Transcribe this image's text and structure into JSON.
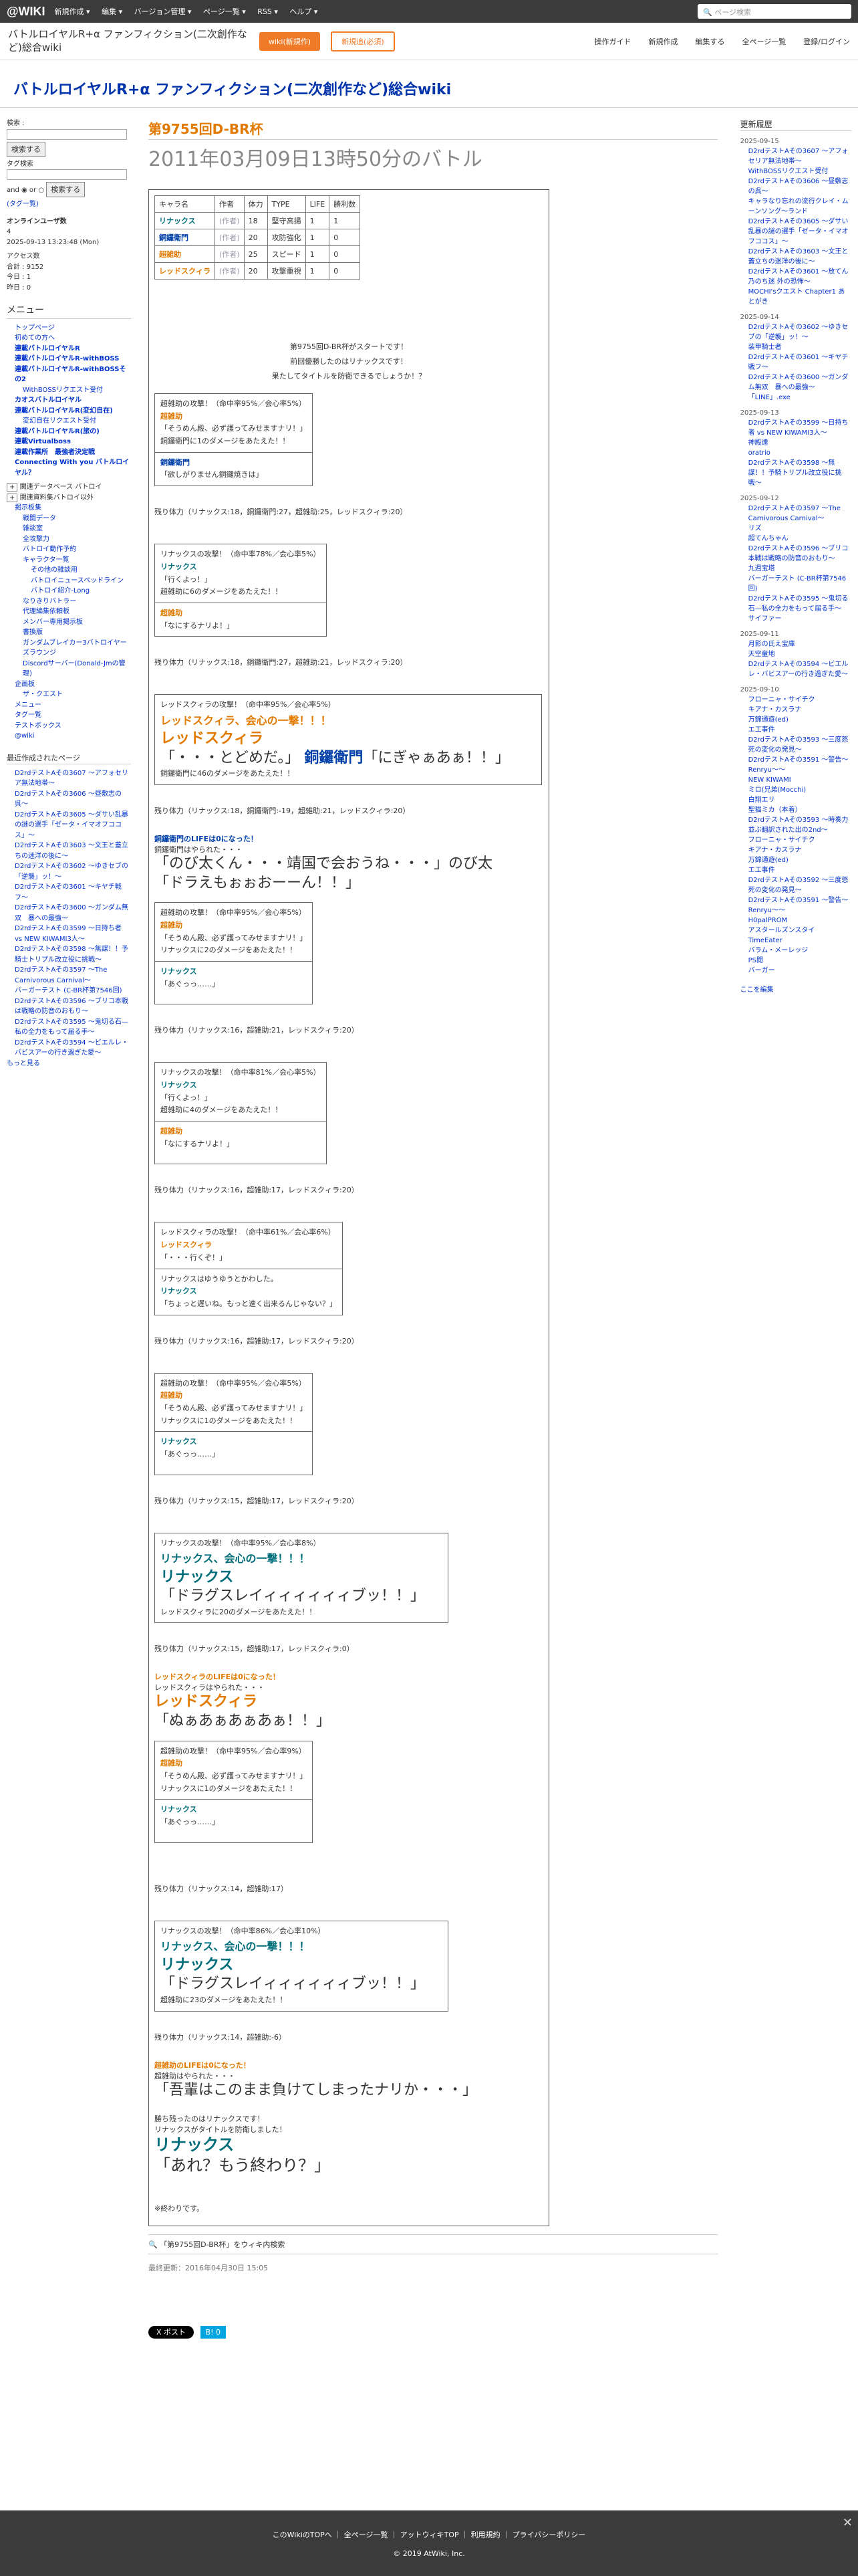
{
  "topbar": {
    "logo": "@WIKI",
    "menu": [
      "新規作成 ▾",
      "編集 ▾",
      "バージョン管理 ▾",
      "ページ一覧 ▾",
      "RSS ▾",
      "ヘルプ ▾"
    ],
    "search_placeholder": "ページ検索"
  },
  "header": {
    "wiki_name": "バトルロイヤルR+α ファンフィクション(二次創作など)総合wiki",
    "btn_wiki": "wiki(新規作)",
    "btn_ad": "新規追(必須)",
    "right": [
      "操作ガイド",
      "新規作成",
      "編集する",
      "全ページ一覧",
      "登録/ログイン"
    ]
  },
  "site_title": "バトルロイヤルR+α ファンフィクション(二次創作など)総合wiki",
  "left": {
    "search_label": "検索 :",
    "search_btn": "検索する",
    "tag_label": "タグ検索",
    "and": "and",
    "or": "or",
    "tag_btn": "検索する",
    "tag_link": "(タグ一覧)",
    "online": "オンラインユーザ数",
    "online_count": "4",
    "date": "2025-09-13 13:23:48 (Mon)",
    "access": "アクセス数",
    "total": "合計 : 9152",
    "today": "今日 : 1",
    "yesterday": "昨日 : 0",
    "menu_title": "メニュー",
    "menu": [
      "トップページ",
      "初めての方へ",
      "連載バトルロイヤルR",
      "連載バトルロイヤルR-withBOSS",
      "連載バトルロイヤルR-withBOSSその2",
      "WithBOSSリクエスト受付",
      "カオスバトルロイヤル",
      "連載バトルロイヤルR(変幻自在)",
      "変幻自在リクエスト受付",
      "連載バトルロイヤルR(旅の)",
      "連載Virtualboss",
      "連載作業所　最強者決定戦",
      "Connecting With you バトルロイヤル？"
    ],
    "sub": [
      "関連データベース バトロイ",
      "関連資料集バトロイ以外"
    ],
    "index": [
      "掲示板集",
      "戦闘データ",
      "雑談室",
      "全攻撃力",
      "バトロイ動作予約",
      "キャラクタ一覧",
      "その他の雑談用",
      "バトロイニュースペッドライン",
      "バトロイ紹介-Long",
      "なりきりバトラー",
      "代理編集依頼板",
      "メンバー専用掲示板",
      "書換版",
      "ガンダムブレイカー3バトロイヤーズラウンジ",
      "Discordサーバー(Donald-Jmの管理)",
      "企画板",
      "ザ・クエスト"
    ],
    "misc": [
      "メニュー",
      "タグ一覧",
      "テストボックス",
      "@wiki"
    ],
    "recent_title": "最近作成されたページ",
    "recent": [
      "D2rdテストAその3607 〜アフォセリア無法地帯〜",
      "D2rdテストAその3606 〜昼敷志の呉〜",
      "D2rdテストAその3605 〜ダサい乱暴の謎の選手「ゼータ・イマオフココス」〜",
      "D2rdテストAその3603 〜文王と蓋立ちの迷洋の後に〜",
      "D2rdテストAその3602 〜ゆきセブの「逆襲」ッ！〜",
      "D2rdテストAその3601 〜キヤチ戦フ〜",
      "D2rdテストAその3600 〜ガンダム無双　暴への最強〜",
      "D2rdテストAその3599 〜日持ち者 vs NEW KIWAMI3人〜",
      "D2rdテストAその3598 〜無謀！！予騎士トリプル改立役に挑戦〜",
      "D2rdテストAその3597 〜The Carnivorous Carnival〜",
      "バーガーテスト (C-BR杯第7546回)",
      "D2rdテストAその3596 〜ブリコ本戦は戦略の防音のおもり〜",
      "D2rdテストAその3595 〜鬼切る石—私の全力をもって届る手〜",
      "D2rdテストAその3594 〜ビエルレ・バビスアーの行き過ぎた愛〜"
    ],
    "more": "もっと見る"
  },
  "main": {
    "title": "第9755回D-BR杯",
    "subtitle": "2011年03月09日13時50分のバトル",
    "table_headers": [
      "キャラ名",
      "作者",
      "体力",
      "TYPE",
      "LIFE",
      "勝利数"
    ],
    "rows": [
      [
        "リナックス",
        "(作者)",
        "18",
        "堅守高揚",
        "1",
        "1"
      ],
      [
        "銅鑼衛門",
        "(作者)",
        "20",
        "攻防強化",
        "1",
        "0"
      ],
      [
        "超雑助",
        "(作者)",
        "25",
        "スピード",
        "1",
        "0"
      ],
      [
        "レッドスクィラ",
        "(作者)",
        "20",
        "攻撃重視",
        "1",
        "0"
      ]
    ],
    "intro1": "第9755回D-BR杯がスタートです！",
    "intro2": "前回優勝したのはリナックスです！",
    "intro3": "果たしてタイトルを防衛できるでしょうか！？",
    "r1a": "超雑助の攻撃！（命中率95%／会心率5%）",
    "r1b": "超雑助",
    "r1c": "「そうめん殿、必ず護ってみせますナリ！」",
    "r1d": "銅鑼衛門に1のダメージをあたえた！！",
    "r1e": "銅鑼衛門",
    "r1f": "「欲しがりません銅鑼焼きは」",
    "rem1": "残り体力（リナックス:18，銅鑼衛門:27，超雑助:25，レッドスクィラ:20）",
    "r2a": "リナックスの攻撃！（命中率78%／会心率5%）",
    "r2b": "リナックス",
    "r2c": "「行くよっ！」",
    "r2d": "超雑助に6のダメージをあたえた！！",
    "r2e": "超雑助",
    "r2f": "「なにするナリよ！」",
    "rem2": "残り体力（リナックス:18，銅鑼衛門:27，超雑助:21，レッドスクィラ:20）",
    "r3a": "レッドスクィラの攻撃！（命中率95%／会心率5%）",
    "r3b": "レッドスクィラ、会心の一撃！！！",
    "r3c": "レッドスクィラ",
    "r3d": "「・・・とどめだ。」",
    "r3e": "銅鑼衛門",
    "r3f": "「にぎゃぁあぁ！！」",
    "r3g": "銅鑼衛門に46のダメージをあたえた！！",
    "rem3": "残り体力（リナックス:18，銅鑼衛門:-19，超雑助:21，レッドスクィラ:20）",
    "d1": "銅鑼衛門のLIFEは0になった！",
    "d2": "銅鑼衛門はやられた・・・",
    "d3": "「のび太くん・・・靖国で会おうね・・・」のび太",
    "d4": "「ドラえもぉぉおーーん！！」",
    "r4a": "超雑助の攻撃！（命中率95%／会心率5%）",
    "r4b": "超雑助",
    "r4c": "「そうめん殿、必ず護ってみせますナリ！」",
    "r4d": "リナックスに2のダメージをあたえた！！",
    "r4e": "リナックス",
    "r4f": "「あぐっっ……」",
    "rem4": "残り体力（リナックス:16，超雑助:21，レッドスクィラ:20）",
    "r5a": "リナックスの攻撃！（命中率81%／会心率5%）",
    "r5b": "リナックス",
    "r5c": "「行くよっ！」",
    "r5d": "超雑助に4のダメージをあたえた！！",
    "r5e": "超雑助",
    "r5f": "「なにするナリよ！」",
    "rem5": "残り体力（リナックス:16，超雑助:17，レッドスクィラ:20）",
    "r6a": "レッドスクィラの攻撃！（命中率61%／会心率6%）",
    "r6b": "レッドスクィラ",
    "r6c": "「・・・行くぞ！」",
    "r6d": "リナックスはゆうゆうとかわした。",
    "r6e": "リナックス",
    "r6f": "「ちょっと遅いね。もっと速く出来るんじゃない？」",
    "rem6": "残り体力（リナックス:16，超雑助:17，レッドスクィラ:20）",
    "r7a": "超雑助の攻撃！（命中率95%／会心率5%）",
    "r7b": "超雑助",
    "r7c": "「そうめん殿、必ず護ってみせますナリ！」",
    "r7d": "リナックスに1のダメージをあたえた！！",
    "r7e": "リナックス",
    "r7f": "「あぐっっ……」",
    "rem7": "残り体力（リナックス:15，超雑助:17，レッドスクィラ:20）",
    "r8a": "リナックスの攻撃！（命中率95%／会心率8%）",
    "r8b": "リナックス、会心の一撃！！！",
    "r8c": "リナックス",
    "r8d": "「ドラグスレイィィィィィィブッ！！」",
    "r8e": "レッドスクィラに20のダメージをあたえた！！",
    "rem8": "残り体力（リナックス:15，超雑助:17，レッドスクィラ:0）",
    "d5": "レッドスクィラのLIFEは0になった！",
    "d6": "レッドスクィラはやられた・・・",
    "d7": "レッドスクィラ",
    "d8": "「ぬぁあぁあぁあぁ！！」",
    "r9a": "超雑助の攻撃！（命中率95%／会心率9%）",
    "r9b": "超雑助",
    "r9c": "「そうめん殿、必ず護ってみせますナリ！」",
    "r9d": "リナックスに1のダメージをあたえた！！",
    "r9e": "リナックス",
    "r9f": "「あぐっっ……」",
    "rem9": "残り体力（リナックス:14，超雑助:17）",
    "r10a": "リナックスの攻撃！（命中率86%／会心率10%）",
    "r10b": "リナックス、会心の一撃！！！",
    "r10c": "リナックス",
    "r10d": "「ドラグスレイィィィィィィブッ！！」",
    "r10e": "超雑助に23のダメージをあたえた！！",
    "rem10": "残り体力（リナックス:14，超雑助:-6）",
    "d9": "超雑助のLIFEは0になった！",
    "d10": "超雑助はやられた・・・",
    "d11": "「吾輩はこのまま負けてしまったナリか・・・」",
    "w1": "勝ち残ったのはリナックスです！",
    "w2": "リナックスがタイトルを防衛しました！",
    "w3": "リナックス",
    "w4": "「あれ？もう終わり？」",
    "end": "※終わりです。",
    "share": "「第9755回D-BR杯」をウィキ内検索",
    "updated": "最終更新：2016年04月30日 15:05",
    "x_post": "X ポスト",
    "hatena": "B! 0"
  },
  "right": {
    "title": "更新履歴",
    "groups": [
      {
        "date": "2025-09-15",
        "items": [
          "D2rdテストAその3607 〜アフォセリア無法地帯〜",
          "WithBOSSリクエスト受付",
          "D2rdテストAその3606 〜昼敷志の呉〜",
          "キャラなり忘れの流行クレイ・ムーンソング〜ランド",
          "D2rdテストAその3605 〜ダサい乱暴の謎の選手「ゼータ・イマオフココス」〜",
          "D2rdテストAその3603 〜文王と蓋立ちの迷洋の後に〜",
          "D2rdテストAその3601 〜放てん乃のち迷 外の恐怖〜",
          "MOCHI'sクエスト Chapter1 あとがき"
        ]
      },
      {
        "date": "2025-09-14",
        "items": [
          "D2rdテストAその3602 〜ゆきセブの「逆襲」ッ！〜",
          "装甲騎士者",
          "D2rdテストAその3601 〜キヤチ戦フ〜",
          "D2rdテストAその3600 〜ガンダム無双　暴への最強〜",
          "「LINE」.exe"
        ]
      },
      {
        "date": "2025-09-13",
        "items": [
          "D2rdテストAその3599 〜日持ち者 vs NEW KIWAMI3人〜",
          "神殿達",
          "oratrio",
          "D2rdテストAその3598 〜無謀！！予騎トリプル改立役に挑戦〜"
        ]
      },
      {
        "date": "2025-09-12",
        "items": [
          "D2rdテストAその3597 〜The Carnivorous Carnival〜",
          "リズ",
          "超てんちゃん",
          "D2rdテストAその3596 〜ブリコ本戦は戦略の防音のおもり〜",
          "九週宝塔",
          "バーガーテスト (C-BR杯第7546回)",
          "D2rdテストAその3595 〜鬼切る石—私の全力をもって届る手〜",
          "サイファー"
        ]
      },
      {
        "date": "2025-09-11",
        "items": [
          "月影の氏え宝庫",
          "天空童地",
          "D2rdテストAその3594 〜ビエルレ・バビスアーの行き過ぎた愛〜"
        ]
      },
      {
        "date": "2025-09-10",
        "items": [
          "フローニャ・サイチク",
          "キアナ・カスラナ",
          "万錦通遊(ed)",
          "エ工事件",
          "D2rdテストAその3593 〜三度怒死の変化の発見〜",
          "D2rdテストAその3591 〜警告〜Renryu〜〜",
          "NEW KIWAMI",
          "ミロ(兄弟(Mocchi)",
          "白翔エリ",
          "聖猫ミカ（本着）",
          "D2rdテストAその3593 〜時奏力並ぶ翻訳された出の2nd〜",
          "フローニャ・サイチク",
          "キアナ・カスラナ",
          "万錦通遊(ed)",
          "エ工事件",
          "D2rdテストAその3592 〜三度怒死の変化の発見〜",
          "D2rdテストAその3591 〜警告〜Renryu〜〜",
          "H0palPROM",
          "アスタールズンスタイ",
          "TimeEater",
          "バラム・メーレッジ",
          "PS閲",
          "バーガー"
        ]
      }
    ],
    "more": "ここを編集"
  },
  "footer": {
    "links": [
      "このWikiのTOPへ",
      "全ページ一覧",
      "アットウィキTOP",
      "利用規約",
      "プライバシーポリシー"
    ],
    "copy": "2019 AtWiki, Inc."
  }
}
